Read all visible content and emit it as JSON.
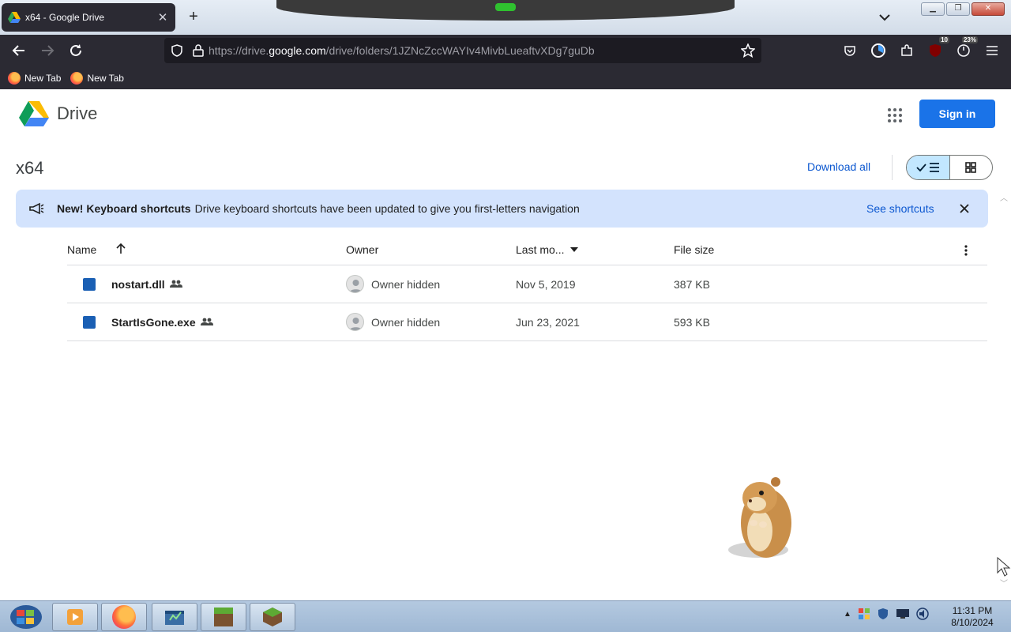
{
  "browser": {
    "tab_title": "x64 - Google Drive",
    "url_prefix": "https://drive.",
    "url_domain": "google.com",
    "url_path": "/drive/folders/1JZNcZccWAYIv4MivbLueaftvXDg7guDb",
    "extension_badge_1": "10",
    "extension_badge_2": "23%",
    "bookmarks": [
      {
        "label": "New Tab"
      },
      {
        "label": "New Tab"
      }
    ]
  },
  "drive": {
    "logo_text": "Drive",
    "sign_in_label": "Sign in",
    "folder_title": "x64",
    "download_all_label": "Download all",
    "banner": {
      "title": "New! Keyboard shortcuts",
      "message": "Drive keyboard shortcuts have been updated to give you first-letters navigation",
      "link": "See shortcuts"
    },
    "columns": {
      "name": "Name",
      "owner": "Owner",
      "last_modified": "Last mo...",
      "file_size": "File size"
    },
    "files": [
      {
        "name": "nostart.dll",
        "owner": "Owner hidden",
        "modified": "Nov 5, 2019",
        "size": "387 KB"
      },
      {
        "name": "StartIsGone.exe",
        "owner": "Owner hidden",
        "modified": "Jun 23, 2021",
        "size": "593 KB"
      }
    ]
  },
  "taskbar": {
    "time": "11:31 PM",
    "date": "8/10/2024"
  },
  "colors": {
    "accent_blue": "#1a73e8",
    "banner_bg": "#d3e3fd",
    "browser_chrome": "#2b2a33"
  }
}
